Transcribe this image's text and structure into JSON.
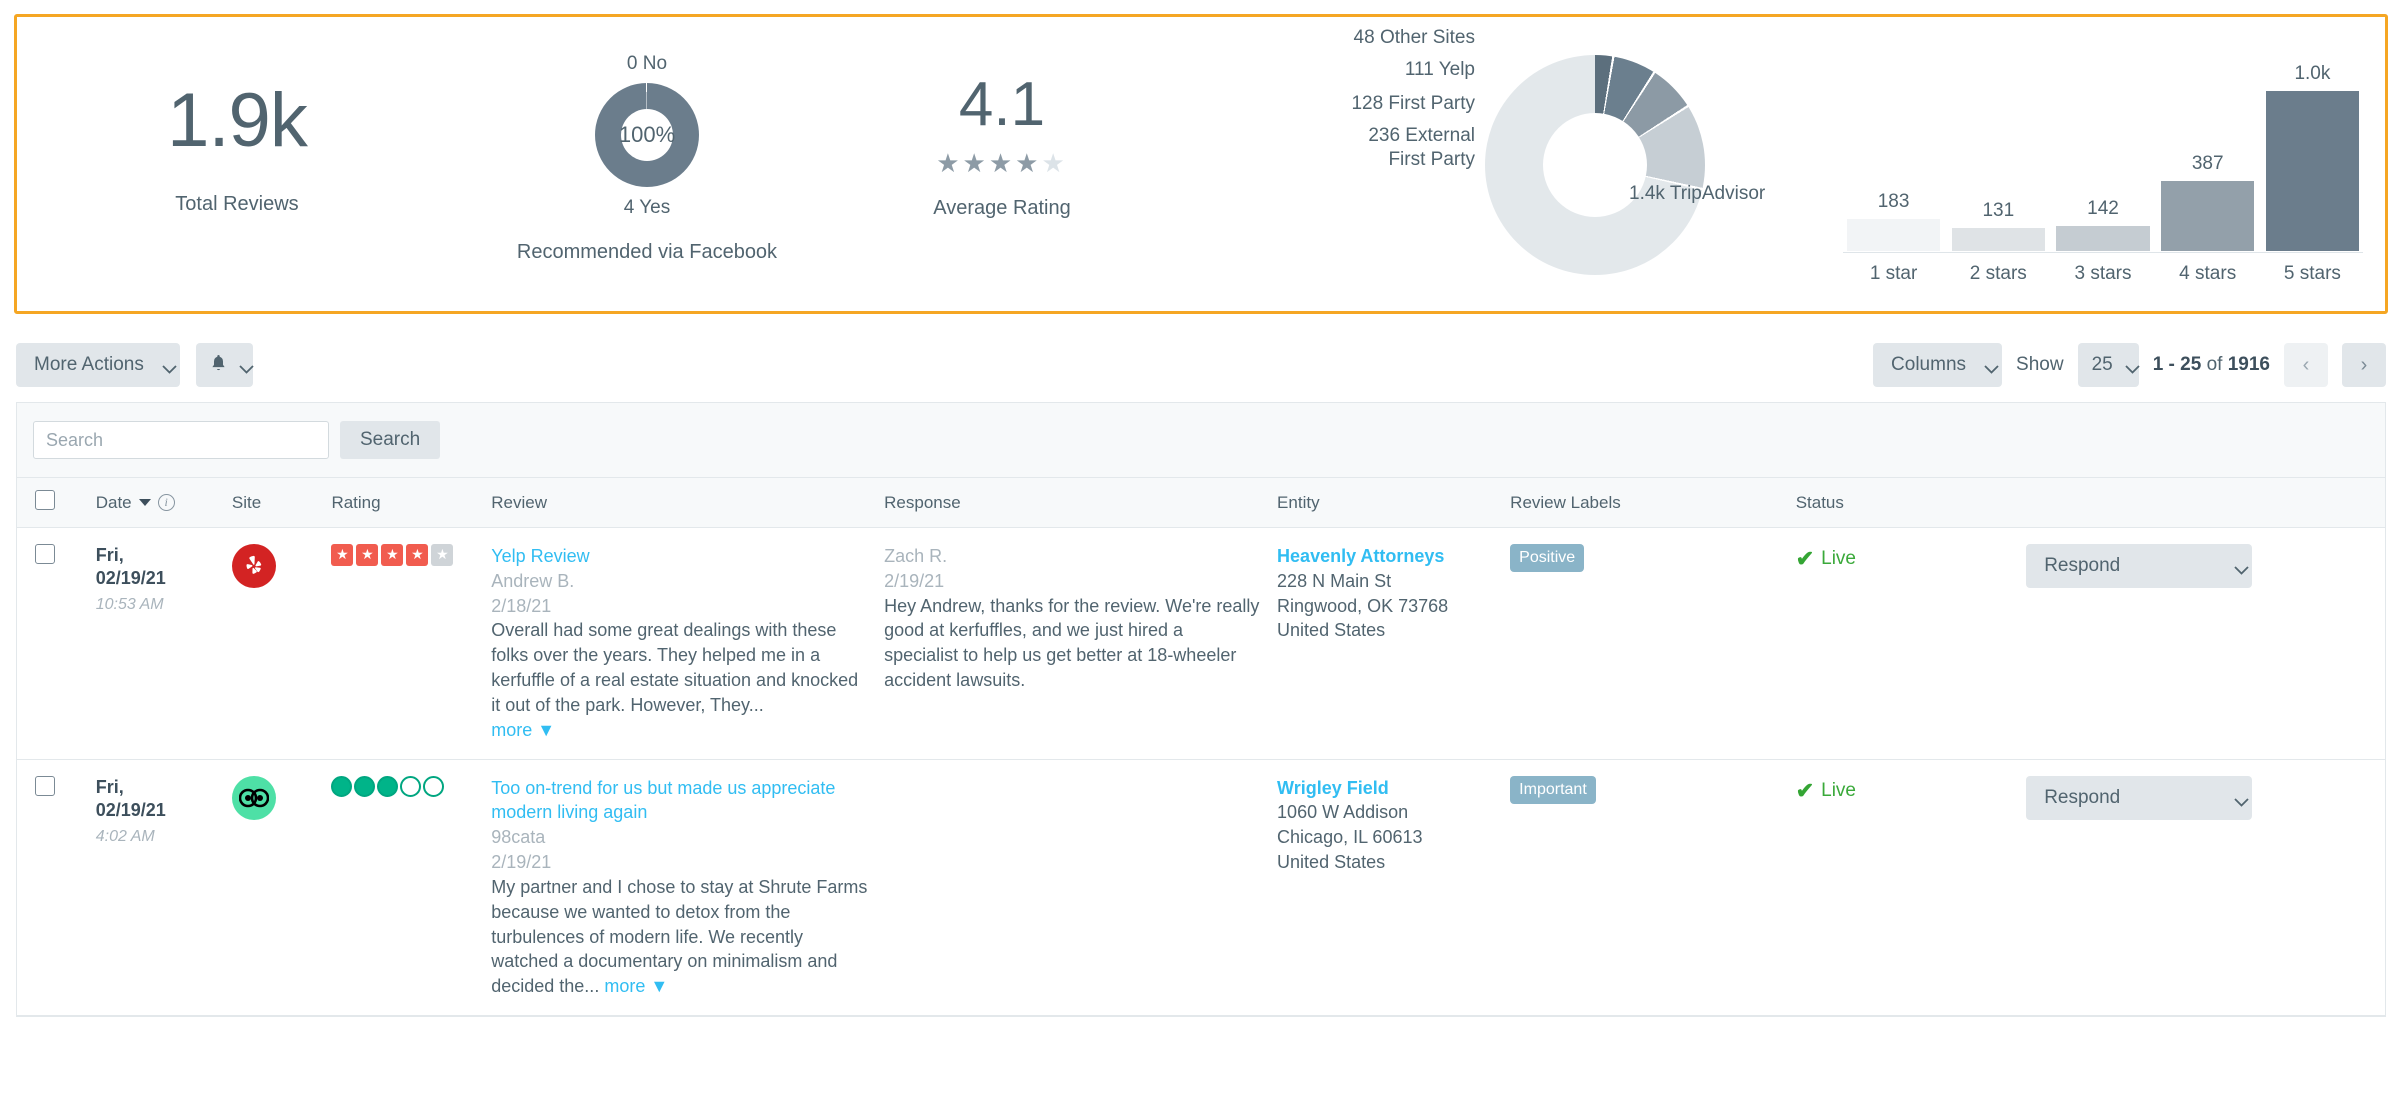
{
  "stats": {
    "total": {
      "value": "1.9k",
      "caption": "Total Reviews"
    },
    "recommended": {
      "top_label": "0 No",
      "center": "100%",
      "bottom_label": "4 Yes",
      "caption": "Recommended via Facebook"
    },
    "average": {
      "value": "4.1",
      "caption": "Average Rating",
      "filled": 4,
      "total": 5
    }
  },
  "chart_data": [
    {
      "type": "pie",
      "title": "Recommended via Facebook",
      "categories": [
        "Yes",
        "No"
      ],
      "values": [
        4,
        0
      ],
      "center_label": "100%",
      "labels": [
        "4 Yes",
        "0 No"
      ],
      "colors": [
        "#6b7d8c",
        "#ffffff"
      ]
    },
    {
      "type": "pie",
      "title": "Reviews by Site",
      "categories": [
        "TripAdvisor",
        "External First Party",
        "First Party",
        "Yelp",
        "Other Sites"
      ],
      "values": [
        1400,
        236,
        128,
        111,
        48
      ],
      "labels": [
        "1.4k TripAdvisor",
        "236 External First Party",
        "128 First Party",
        "111 Yelp",
        "48 Other Sites"
      ],
      "colors": [
        "#e3e8eb",
        "#c6ced4",
        "#8c9aa5",
        "#6b7f8e",
        "#5c6f7d"
      ],
      "legend": "callout-labels"
    },
    {
      "type": "bar",
      "title": "Reviews by Star Rating",
      "categories": [
        "1 star",
        "2 stars",
        "3 stars",
        "4 stars",
        "5 stars"
      ],
      "values": [
        183,
        131,
        142,
        387,
        1000
      ],
      "value_labels": [
        "183",
        "131",
        "142",
        "387",
        "1.0k"
      ],
      "colors": [
        "#f2f4f6",
        "#dfe3e6",
        "#c5ccd2",
        "#93a0aa",
        "#6b7d8c"
      ],
      "xlabel": "",
      "ylabel": "",
      "ylim": [
        0,
        1000
      ],
      "grid": false
    }
  ],
  "sites_chart": {
    "labels": [
      {
        "text": "48 Other Sites"
      },
      {
        "text": "111 Yelp"
      },
      {
        "text": "128 First Party"
      },
      {
        "text": "236 External",
        "text2": "First Party"
      },
      {
        "text": "1.4k TripAdvisor"
      }
    ]
  },
  "toolbar": {
    "more_actions": "More Actions",
    "bell_icon": "bell-icon",
    "columns": "Columns",
    "show_label": "Show",
    "page_size": "25",
    "range_start": "1 - 25",
    "range_of": "of",
    "range_total": "1916",
    "prev": "‹",
    "next": "›"
  },
  "search": {
    "placeholder": "Search",
    "value": "",
    "button": "Search"
  },
  "table": {
    "headers": {
      "date": "Date",
      "site": "Site",
      "rating": "Rating",
      "review": "Review",
      "response": "Response",
      "entity": "Entity",
      "labels": "Review Labels",
      "status": "Status"
    },
    "rows": [
      {
        "date_main": "Fri,",
        "date_main2": "02/19/21",
        "date_time": "10:53 AM",
        "site": "yelp",
        "rating_type": "stars",
        "rating_filled": 4,
        "rating_total": 5,
        "review_title": "Yelp Review",
        "review_author": "Andrew B.",
        "review_date": "2/18/21",
        "review_body": "Overall had some great dealings with these folks over the years. They helped me in a kerfuffle of a real estate situation and knocked it out of the park. However, They...",
        "review_more": "more",
        "response_author": "Zach R.",
        "response_date": "2/19/21",
        "response_body": "Hey Andrew, thanks for the review. We're really good at kerfuffles, and we just hired a specialist to help us get better at 18-wheeler accident lawsuits.",
        "entity_name": "Heavenly Attorneys",
        "entity_address1": "228 N Main St",
        "entity_address2": "Ringwood, OK 73768",
        "entity_country": "United States",
        "label_chip": "Positive",
        "status": "Live",
        "action": "Respond"
      },
      {
        "date_main": "Fri,",
        "date_main2": "02/19/21",
        "date_time": "4:02 AM",
        "site": "tripadvisor",
        "rating_type": "circles",
        "rating_filled": 3,
        "rating_total": 5,
        "review_title": "Too on-trend for us but made us appreciate modern living again",
        "review_author": "98cata",
        "review_date": "2/19/21",
        "review_body": "My partner and I chose to stay at Shrute Farms because we wanted to detox from the turbulences of modern life. We recently watched a documentary on minimalism and decided the...",
        "review_more": "more",
        "response_author": "",
        "response_date": "",
        "response_body": "",
        "entity_name": "Wrigley Field",
        "entity_address1": "1060 W Addison",
        "entity_address2": "Chicago, IL 60613",
        "entity_country": "United States",
        "label_chip": "Important",
        "status": "Live",
        "action": "Respond"
      }
    ]
  }
}
